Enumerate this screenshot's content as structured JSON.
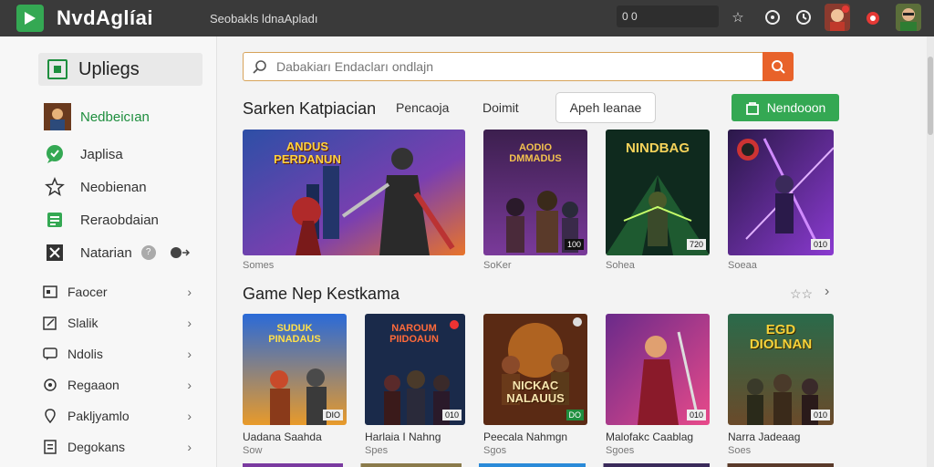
{
  "app": {
    "brand": "NvdAglíai",
    "top_search_text": "Seobakls ldnaApladı",
    "top_field_text": "0 0"
  },
  "search": {
    "placeholder": "Dabakiarı Endacları ondlajn"
  },
  "sidebar": {
    "header": "Upliegs",
    "items": [
      {
        "label": "Nedbeicıan",
        "icon": "game-thumb-icon",
        "active": true
      },
      {
        "label": "Japlisa",
        "icon": "chat-bubble-icon"
      },
      {
        "label": "Neobienan",
        "icon": "star-outline-icon"
      },
      {
        "label": "Reraobdaian",
        "icon": "list-doc-icon"
      },
      {
        "label": "Natarian",
        "icon": "x-box-icon",
        "badge": "?"
      }
    ],
    "subitems": [
      {
        "label": "Faocer",
        "icon": "image-icon"
      },
      {
        "label": "Slalik",
        "icon": "edit-icon"
      },
      {
        "label": "Ndolis",
        "icon": "chat-icon"
      },
      {
        "label": "Regaaon",
        "icon": "circle-icon"
      },
      {
        "label": "Pakljyamlo",
        "icon": "pin-icon"
      },
      {
        "label": "Degokans",
        "icon": "document-icon"
      }
    ]
  },
  "featured": {
    "title": "Sarken Katpiacian",
    "tabs": [
      "Pencaoja",
      "Doimit"
    ],
    "pill": "Apeh leanae",
    "install": "Nendooon",
    "tiles": [
      {
        "caption": "Somes",
        "art": "ANDUS PERDANUN",
        "badge": ""
      },
      {
        "caption": "SoKer",
        "art": "AODIO DMMADUS",
        "badge": "100"
      },
      {
        "caption": "Sohea",
        "art": "NINDBAG",
        "badge": "720"
      },
      {
        "caption": "Soeaa",
        "art": "",
        "badge": "010"
      }
    ]
  },
  "second": {
    "title": "Game Nep Kestkama",
    "tiles": [
      {
        "caption": "Uadana Saahda",
        "sub": "Sow",
        "art": "SUDUK PINADAUS",
        "badge": "DIO"
      },
      {
        "caption": "Harlaia I Nahng",
        "sub": "Spes",
        "art": "NAROUM PIIDOAUN",
        "badge": "010"
      },
      {
        "caption": "Peecala Nahmgn",
        "sub": "Sgos",
        "art": "NICKAC NALAUUS",
        "badge": "DO"
      },
      {
        "caption": "Malofakc Caablag",
        "sub": "Sgoes",
        "art": "",
        "badge": "010"
      },
      {
        "caption": "Narra Jadeaag",
        "sub": "Soes",
        "art": "EGD DIOLNAN",
        "badge": "010"
      }
    ]
  },
  "colors": {
    "accent_green": "#34a853",
    "accent_orange": "#e8622a",
    "topbar": "#3a3a3a"
  }
}
